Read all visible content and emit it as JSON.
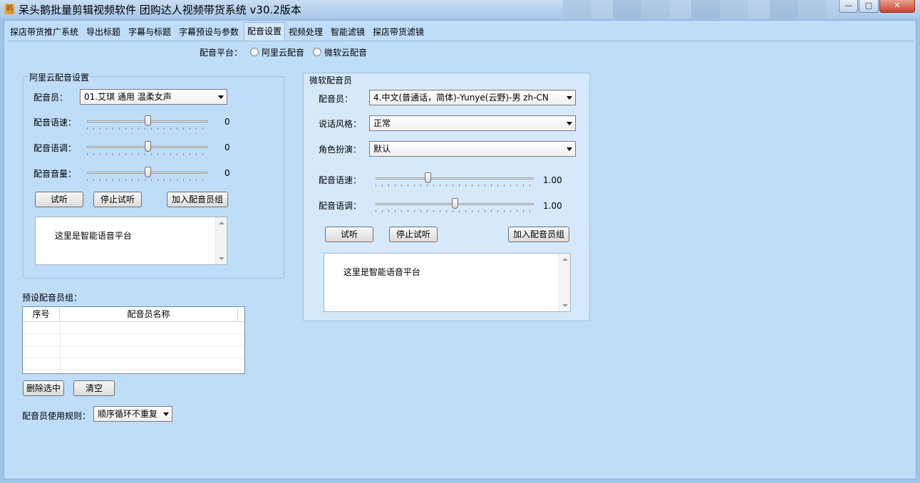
{
  "window": {
    "title": "呆头鹅批量剪辑视频软件    团购达人视频带货系统   v30.2版本"
  },
  "tabs": [
    {
      "label": "探店带货推广系统"
    },
    {
      "label": "导出标题"
    },
    {
      "label": "字幕与标题"
    },
    {
      "label": "字幕预设与参数"
    },
    {
      "label": "配音设置"
    },
    {
      "label": "视频处理"
    },
    {
      "label": "智能滤镜"
    },
    {
      "label": "探店带货滤镜"
    }
  ],
  "active_tab": "配音设置",
  "platform": {
    "label": "配音平台：",
    "options": [
      "阿里云配音",
      "微软云配音"
    ]
  },
  "aliyun": {
    "title": "阿里云配音设置",
    "voice_label": "配音员：",
    "voice_value": "01.艾琪 通用 温柔女声",
    "speed_label": "配音语速：",
    "speed_value": "0",
    "speed_level": 0.5,
    "pitch_label": "配音语调：",
    "pitch_value": "0",
    "pitch_level": 0.5,
    "volume_label": "配音音量：",
    "volume_value": "0",
    "volume_level": 0.5,
    "listen_btn": "试听",
    "stop_btn": "停止试听",
    "add_btn": "加入配音员组",
    "text": "这里是智能语音平台"
  },
  "microsoft": {
    "title": "微软配音员",
    "voice_label": "配音员：",
    "voice_value": "4.中文(普通话，简体)-Yunye(云野)-男 zh-CN",
    "style_label": "说话风格：",
    "style_value": "正常",
    "role_label": "角色扮演：",
    "role_value": "默认",
    "speed_label": "配音语速：",
    "speed_value": "1.00",
    "speed_level": 0.33,
    "pitch_label": "配音语调：",
    "pitch_value": "1.00",
    "pitch_level": 0.5,
    "listen_btn": "试听",
    "stop_btn": "停止试听",
    "add_btn": "加入配音员组",
    "text": "这里是智能语音平台"
  },
  "preset_group": {
    "label": "预设配音员组：",
    "columns": [
      "序号",
      "配音员名称"
    ],
    "rows": [],
    "delete_btn": "删除选中",
    "clear_btn": "清空",
    "rule_label": "配音员使用规则：",
    "rule_value": "顺序循环不重复"
  }
}
